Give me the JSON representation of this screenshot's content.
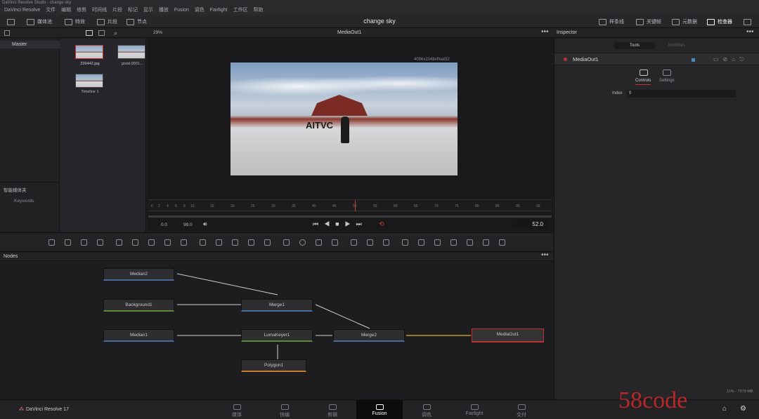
{
  "window": {
    "title": "DaVinci Resolve Studio - change sky"
  },
  "menu": [
    "DaVinci Resolve",
    "文件",
    "编辑",
    "修剪",
    "时间线",
    "片段",
    "标记",
    "显示",
    "播放",
    "Fusion",
    "调色",
    "Fairlight",
    "工作区",
    "帮助"
  ],
  "topbar": {
    "media_pool": "媒体池",
    "effects": "特效",
    "clips": "片段",
    "nodes": "节点",
    "project_title": "change sky",
    "spline": "样条线",
    "keyframes": "关键帧",
    "metadata": "元数据",
    "inspector": "检查器"
  },
  "viewer": {
    "zoom": "29%",
    "name": "MediaOut1",
    "resolution": "4096x2048xfloat32",
    "overlay_text": "AITVC",
    "tc_start": "0.0",
    "tc_end": "99.0",
    "current_frame": "52.0",
    "ticks": [
      "0",
      "2",
      "4",
      "6",
      "8",
      "10",
      "15",
      "20",
      "25",
      "30",
      "35",
      "40",
      "45",
      "50",
      "55",
      "60",
      "65",
      "70",
      "75",
      "80",
      "85",
      "90",
      "95"
    ]
  },
  "mediapool": {
    "root": "Master",
    "smart_bins": "智能媒体夹",
    "keywords": "Keywords",
    "clips": [
      {
        "name": "226442.jpg"
      },
      {
        "name": "good.0001..."
      },
      {
        "name": "Timeline 1"
      }
    ]
  },
  "inspector": {
    "title": "Inspector",
    "tab_tools": "Tools",
    "tab_modifiers": "Modifiers",
    "node_name": "MediaOut1",
    "sub_controls": "Controls",
    "sub_settings": "Settings",
    "index_label": "Index",
    "index_value": "0"
  },
  "nodes_panel": {
    "title": "Nodes",
    "items": [
      {
        "id": "Median2"
      },
      {
        "id": "Background1"
      },
      {
        "id": "Merge1"
      },
      {
        "id": "Median1"
      },
      {
        "id": "LumaKeyer1"
      },
      {
        "id": "Merge2"
      },
      {
        "id": "MediaOut1"
      },
      {
        "id": "Polygon1"
      }
    ],
    "status": "11% - 7379 MB"
  },
  "pages": [
    {
      "label": "媒体",
      "icon": "media-page-icon"
    },
    {
      "label": "快编",
      "icon": "cut-page-icon"
    },
    {
      "label": "剪辑",
      "icon": "edit-page-icon"
    },
    {
      "label": "Fusion",
      "icon": "fusion-page-icon"
    },
    {
      "label": "调色",
      "icon": "color-page-icon"
    },
    {
      "label": "Fairlight",
      "icon": "fairlight-page-icon"
    },
    {
      "label": "交付",
      "icon": "deliver-page-icon"
    }
  ],
  "footer": {
    "brand": "DaVinci Resolve 17",
    "watermark": "58code"
  },
  "colors": {
    "accent": "#c13030",
    "link_blue": "#4a6a9a",
    "active_page": "#0c0c0d",
    "playhead": "#d43a3a"
  }
}
